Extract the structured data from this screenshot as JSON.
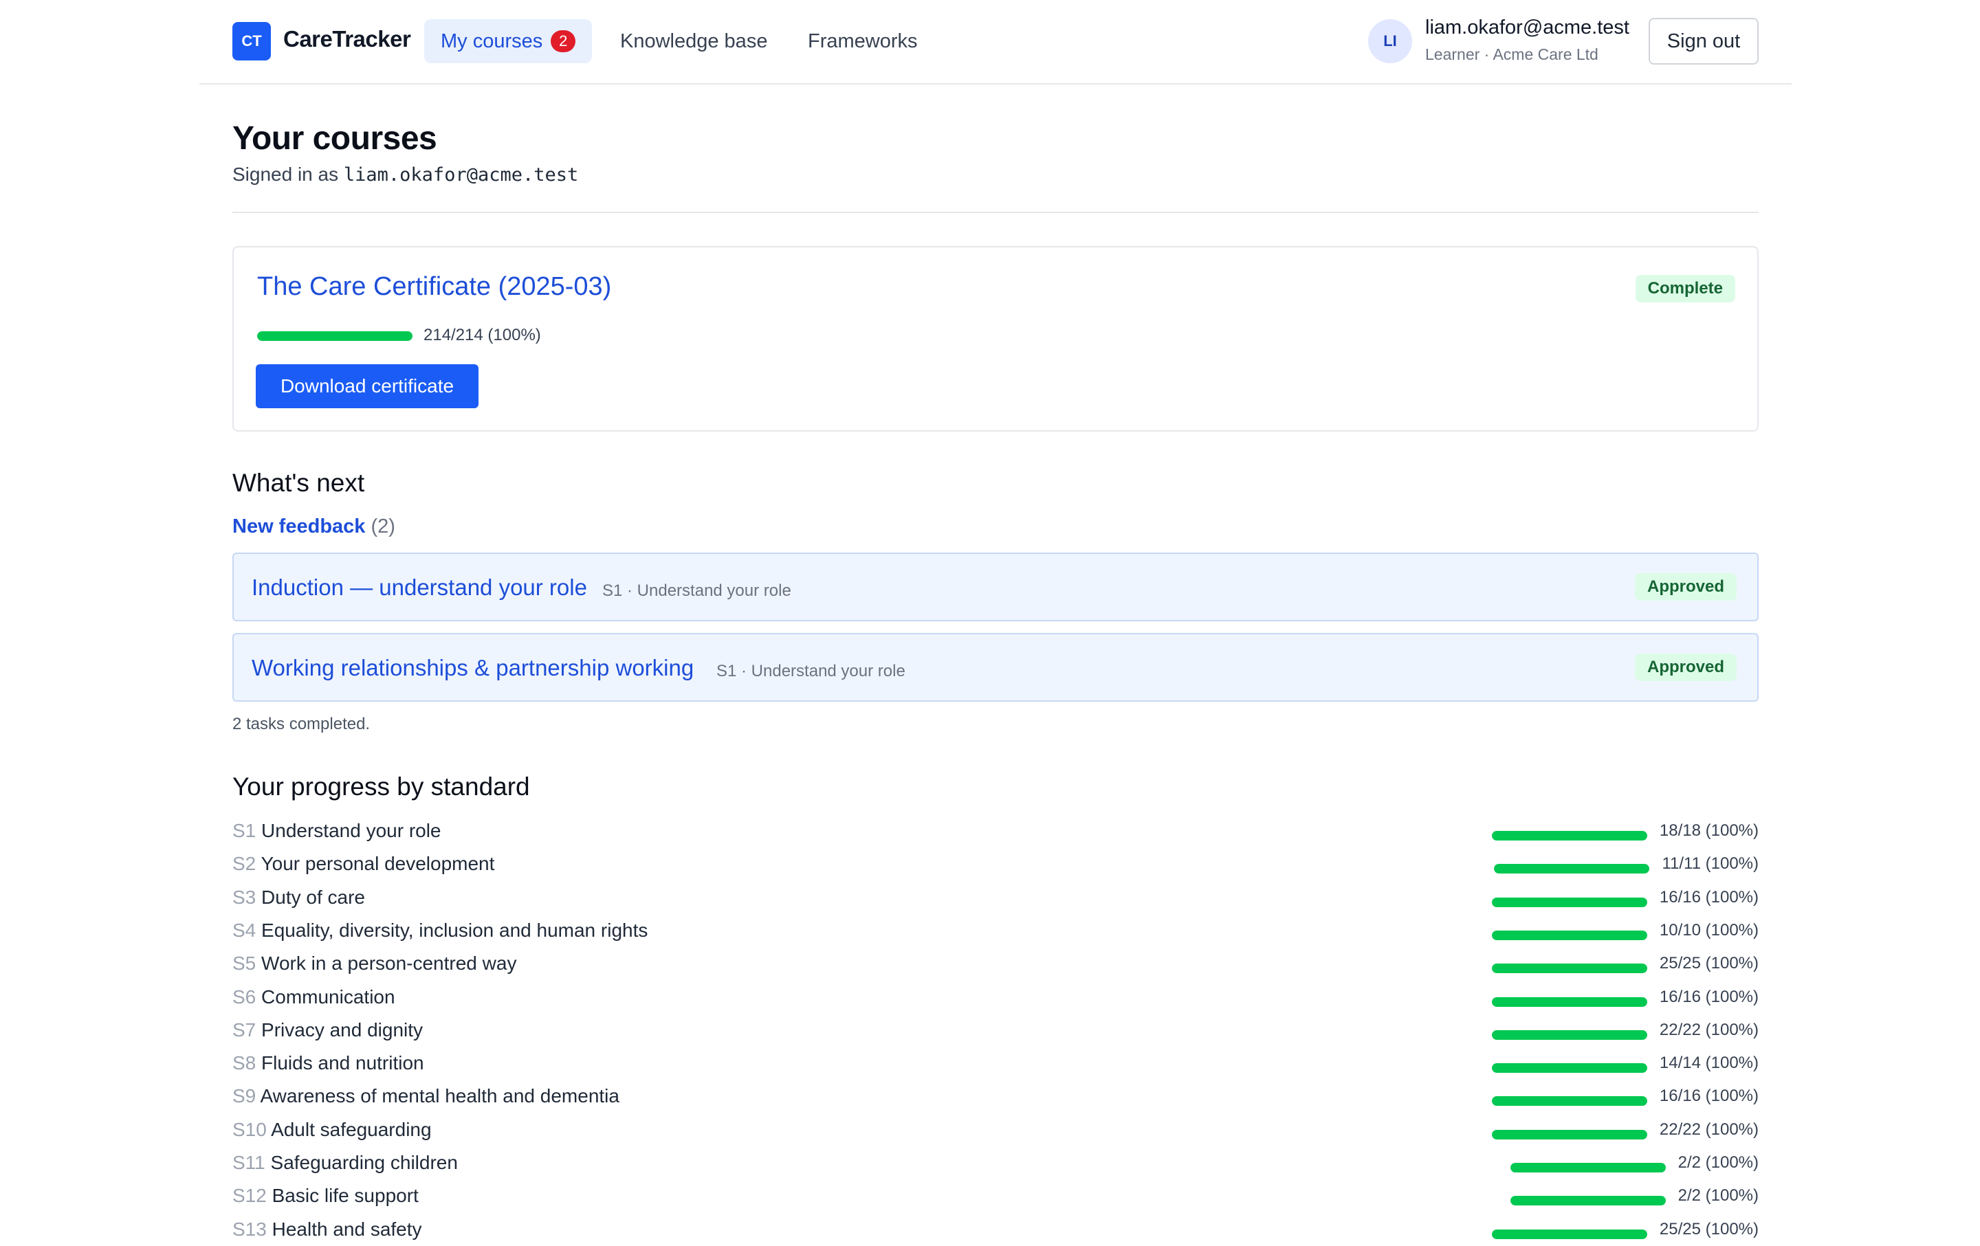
{
  "header": {
    "logo_initials": "CT",
    "brand": "CareTracker",
    "nav": [
      {
        "label": "My courses",
        "badge": "2"
      },
      {
        "label": "Knowledge base"
      },
      {
        "label": "Frameworks"
      }
    ],
    "user": {
      "initials": "LI",
      "email": "liam.okafor@acme.test",
      "subtitle": "Learner · Acme Care Ltd"
    },
    "sign_out_label": "Sign out"
  },
  "main": {
    "title": "Your courses",
    "signed_in_prefix": "Signed in as",
    "signed_in_email": "liam.okafor@acme.test"
  },
  "course": {
    "title": "The Care Certificate (2025-03)",
    "status": "Complete",
    "progress_fraction": 1.0,
    "progress_text": "214/214 (100%)",
    "download_label": "Download certificate"
  },
  "whats_next": {
    "heading": "What's next",
    "feedback_label": "New feedback",
    "feedback_count": "(2)",
    "tasks": [
      {
        "title": "Induction — understand your role",
        "meta": "S1 · Understand your role",
        "status": "Approved"
      },
      {
        "title": "Working relationships & partnership working",
        "meta": "S1 · Understand your role",
        "status": "Approved"
      }
    ],
    "tasks_completed": "2 tasks completed."
  },
  "progress": {
    "heading": "Your progress by standard",
    "standards": [
      {
        "code": "S1",
        "name": "Understand your role",
        "count": "18/18 (100%)",
        "fraction": 1.0
      },
      {
        "code": "S2",
        "name": "Your personal development",
        "count": "11/11 (100%)",
        "fraction": 1.0
      },
      {
        "code": "S3",
        "name": "Duty of care",
        "count": "16/16 (100%)",
        "fraction": 1.0
      },
      {
        "code": "S4",
        "name": "Equality, diversity, inclusion and human rights",
        "count": "10/10 (100%)",
        "fraction": 1.0
      },
      {
        "code": "S5",
        "name": "Work in a person-centred way",
        "count": "25/25 (100%)",
        "fraction": 1.0
      },
      {
        "code": "S6",
        "name": "Communication",
        "count": "16/16 (100%)",
        "fraction": 1.0
      },
      {
        "code": "S7",
        "name": "Privacy and dignity",
        "count": "22/22 (100%)",
        "fraction": 1.0
      },
      {
        "code": "S8",
        "name": "Fluids and nutrition",
        "count": "14/14 (100%)",
        "fraction": 1.0
      },
      {
        "code": "S9",
        "name": "Awareness of mental health and dementia",
        "count": "16/16 (100%)",
        "fraction": 1.0
      },
      {
        "code": "S10",
        "name": "Adult safeguarding",
        "count": "22/22 (100%)",
        "fraction": 1.0
      },
      {
        "code": "S11",
        "name": "Safeguarding children",
        "count": "2/2 (100%)",
        "fraction": 1.0
      },
      {
        "code": "S12",
        "name": "Basic life support",
        "count": "2/2 (100%)",
        "fraction": 1.0
      },
      {
        "code": "S13",
        "name": "Health and safety",
        "count": "25/25 (100%)",
        "fraction": 1.0
      }
    ]
  },
  "colors": {
    "accent": "#1a5cf5",
    "link": "#1d4ed8",
    "progress_green": "#00c850",
    "badge_red": "#e11d2a",
    "status_bg": "#dcfce7",
    "status_text": "#166534"
  }
}
